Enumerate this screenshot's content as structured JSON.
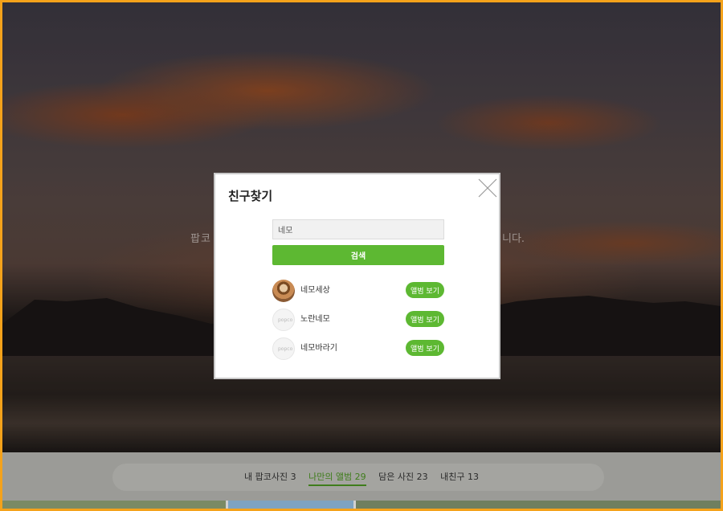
{
  "background": {
    "hero_text_left": "팝코 ",
    "hero_text_right": "니다."
  },
  "tabs": [
    {
      "label": "내 팝코사진 3",
      "active": false
    },
    {
      "label": "나만의 앨범 29",
      "active": true
    },
    {
      "label": "담은 사진 23",
      "active": false
    },
    {
      "label": "내친구 13",
      "active": false
    }
  ],
  "modal": {
    "title": "친구찾기",
    "search_value": "네모",
    "search_button": "검색",
    "results": [
      {
        "name": "네모세상",
        "avatar": "photo",
        "button": "앨범 보기"
      },
      {
        "name": "노란네모",
        "avatar": "default",
        "button": "앨범 보기"
      },
      {
        "name": "네모바라기",
        "avatar": "default",
        "button": "앨범 보기"
      }
    ]
  },
  "colors": {
    "accent": "#5db832",
    "frame": "#f4a21b",
    "active_tab": "#3f7d1c"
  },
  "icons": [
    "close-icon",
    "default-avatar-icon"
  ]
}
